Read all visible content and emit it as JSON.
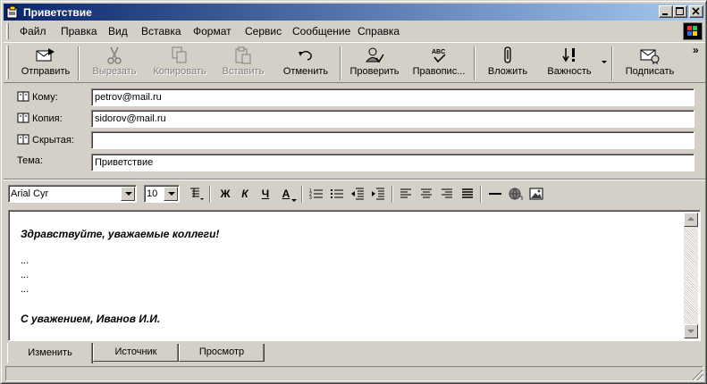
{
  "window": {
    "title": "Приветствие"
  },
  "menu": [
    "Файл",
    "Правка",
    "Вид",
    "Вставка",
    "Формат",
    "Сервис",
    "Сообщение",
    "Справка"
  ],
  "toolbar": {
    "send": "Отправить",
    "cut": "Вырезать",
    "copy": "Копировать",
    "paste": "Вставить",
    "undo": "Отменить",
    "check": "Проверить",
    "spelling": "Правопис...",
    "attach": "Вложить",
    "priority": "Важность",
    "sign": "Подписать",
    "overflow": "»"
  },
  "header": {
    "to_label": "Кому:",
    "to_value": "petrov@mail.ru",
    "cc_label": "Копия:",
    "cc_value": "sidorov@mail.ru",
    "bcc_label": "Скрытая:",
    "bcc_value": "",
    "subject_label": "Тема:",
    "subject_value": "Приветствие"
  },
  "format": {
    "font": "Arial Cyr",
    "size": "10",
    "bold": "Ж",
    "italic": "К",
    "underline": "Ч",
    "color": "А"
  },
  "body": {
    "greeting": "Здравствуйте, уважаемые коллеги!",
    "dots": [
      "...",
      "...",
      "..."
    ],
    "signature": "С уважением, Иванов И.И."
  },
  "tabs": [
    "Изменить",
    "Источник",
    "Просмотр"
  ]
}
